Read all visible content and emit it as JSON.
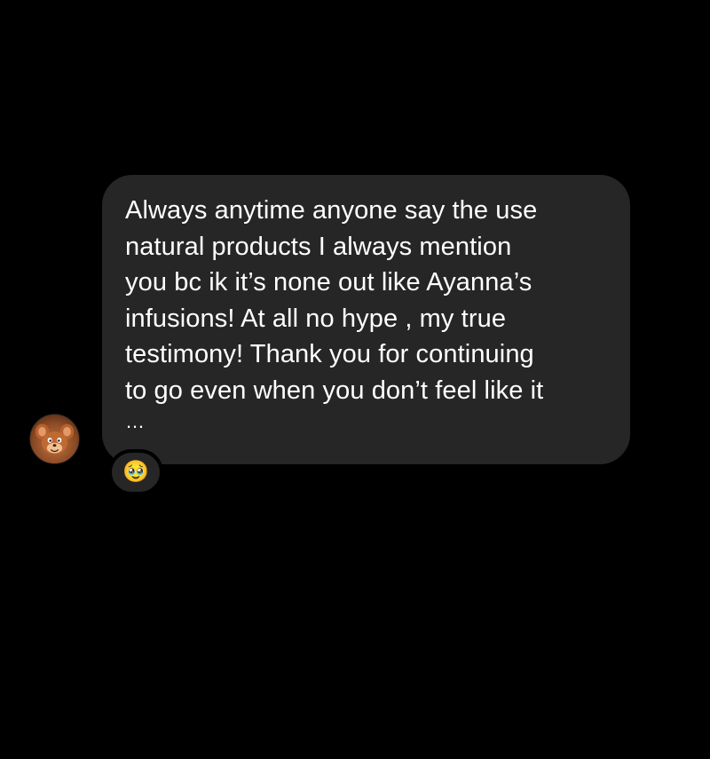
{
  "conversation": {
    "message": {
      "text": "Always anytime anyone say the use\nnatural products I always mention\nyou bc ik it’s none out like Ayanna’s\ninfusions! At all no hype , my true\ntestimony! Thank you for continuing\nto go even when you don’t feel like it",
      "ellipsis": "…"
    },
    "reaction": {
      "emoji": "🥹"
    },
    "sender_avatar": {
      "icon": "cartoon-mouse-avatar-icon"
    }
  },
  "colors": {
    "background": "#000000",
    "bubble": "#262626",
    "text": "#ffffff"
  }
}
